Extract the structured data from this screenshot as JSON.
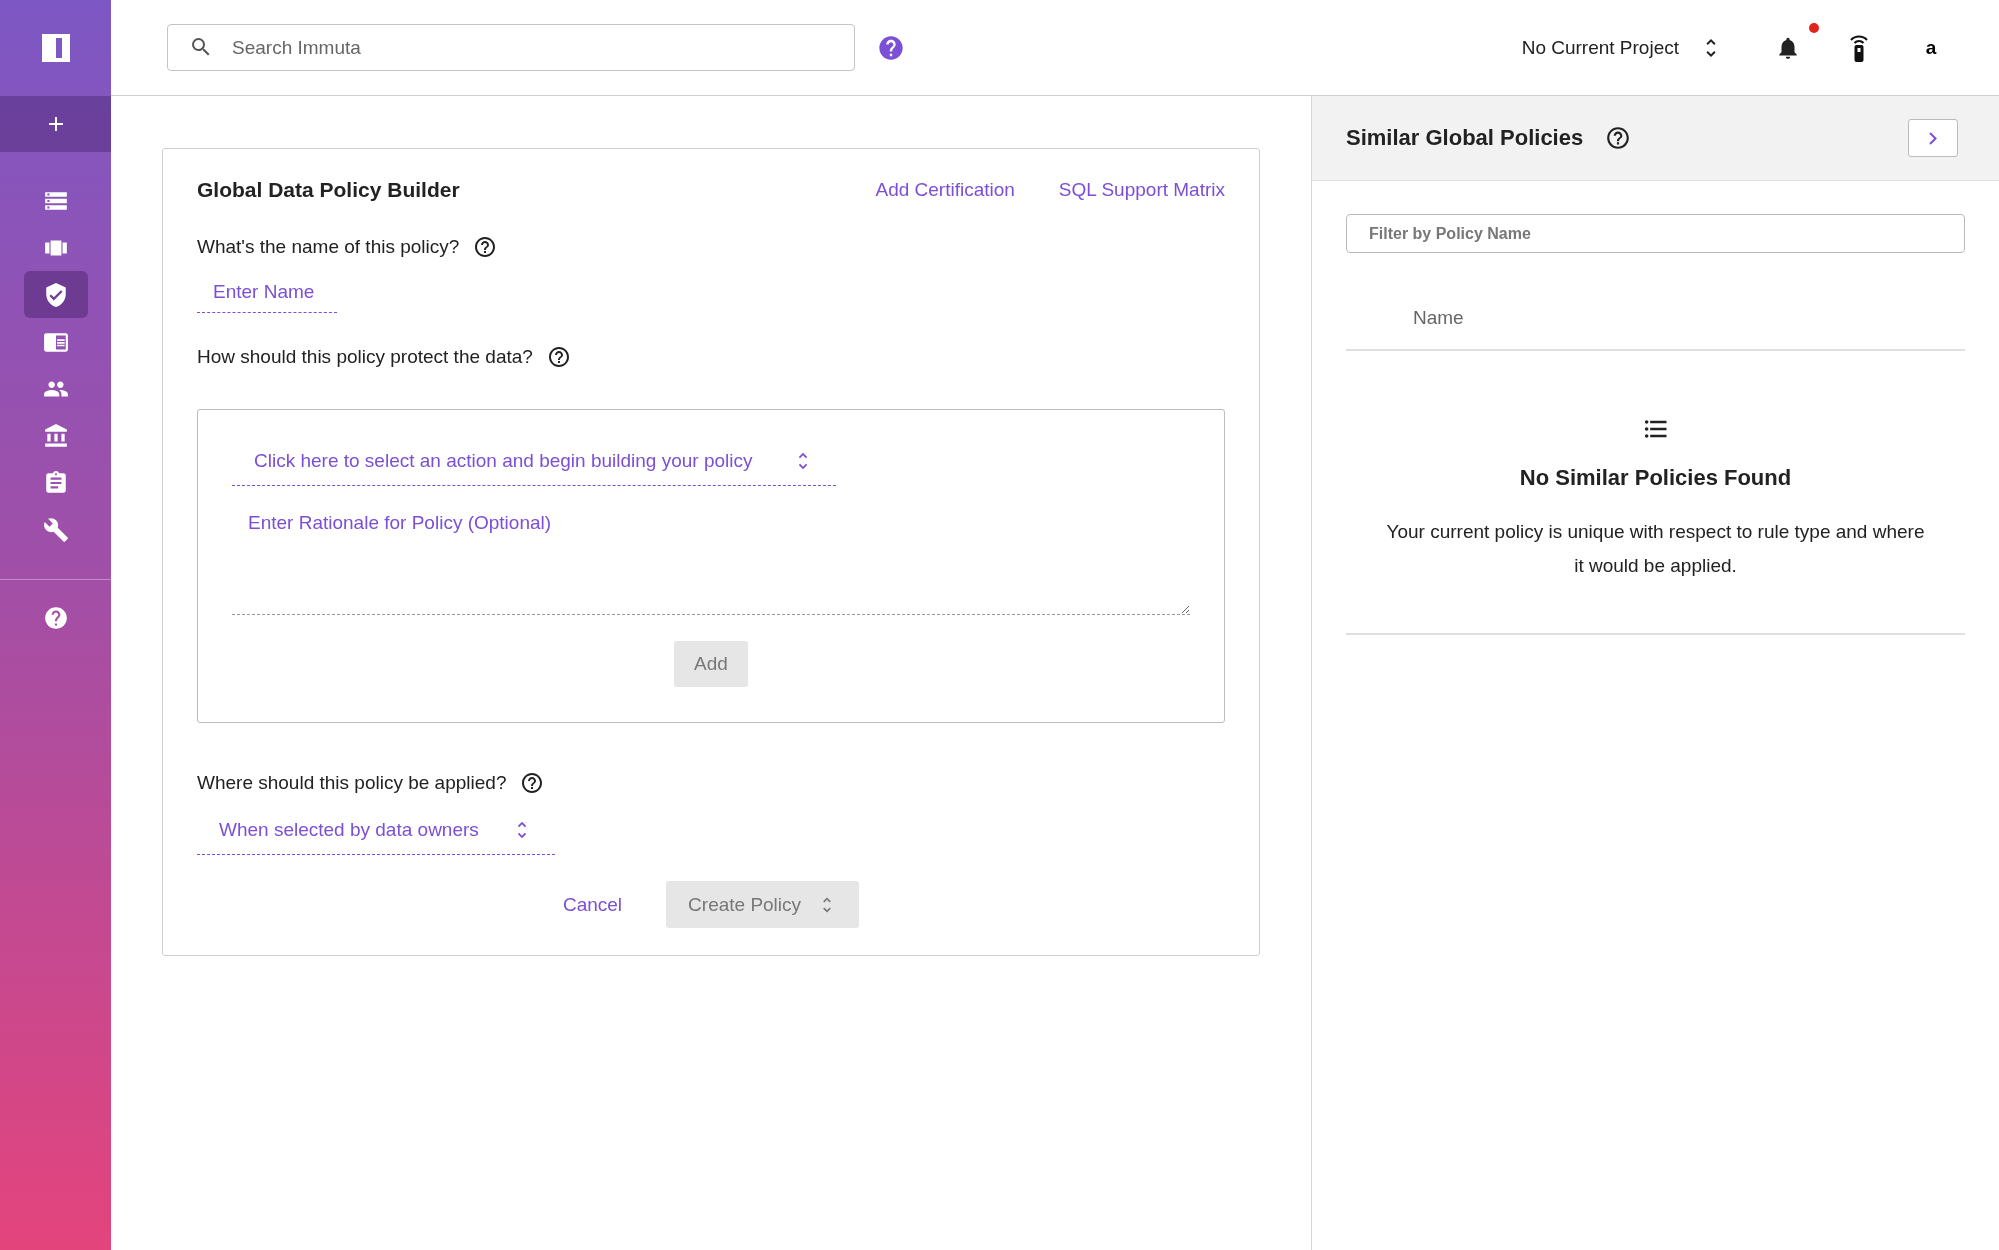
{
  "sidebar": {
    "items": [
      {
        "selected": false
      },
      {
        "selected": false
      },
      {
        "selected": true
      },
      {
        "selected": false
      },
      {
        "selected": false
      },
      {
        "selected": false
      },
      {
        "selected": false
      },
      {
        "selected": false
      }
    ]
  },
  "topbar": {
    "search": {
      "placeholder": "Search Immuta"
    },
    "project": "No Current Project",
    "notifications": {
      "unread": true
    },
    "user_initial": "a"
  },
  "builder": {
    "title": "Global Data Policy Builder",
    "links": [
      "Add Certification",
      "SQL Support Matrix"
    ],
    "name_question": "What's the name of this policy?",
    "name_placeholder": "Enter Name",
    "protect_question": "How should this policy protect the data?",
    "action_select": "Click here to select an action and begin building your policy",
    "rationale_placeholder": "Enter Rationale for Policy (Optional)",
    "add_button": {
      "label": "Add",
      "disabled": true
    },
    "apply_question": "Where should this policy be applied?",
    "apply_select": "When selected by data owners",
    "cancel": "Cancel",
    "create_button": {
      "label": "Create Policy",
      "disabled": true
    }
  },
  "similar_panel": {
    "title": "Similar Global Policies",
    "filter_placeholder": "Filter by Policy Name",
    "column": "Name",
    "empty_title": "No Similar Policies Found",
    "empty_text": "Your current policy is unique with respect to rule type and where it would be applied."
  }
}
